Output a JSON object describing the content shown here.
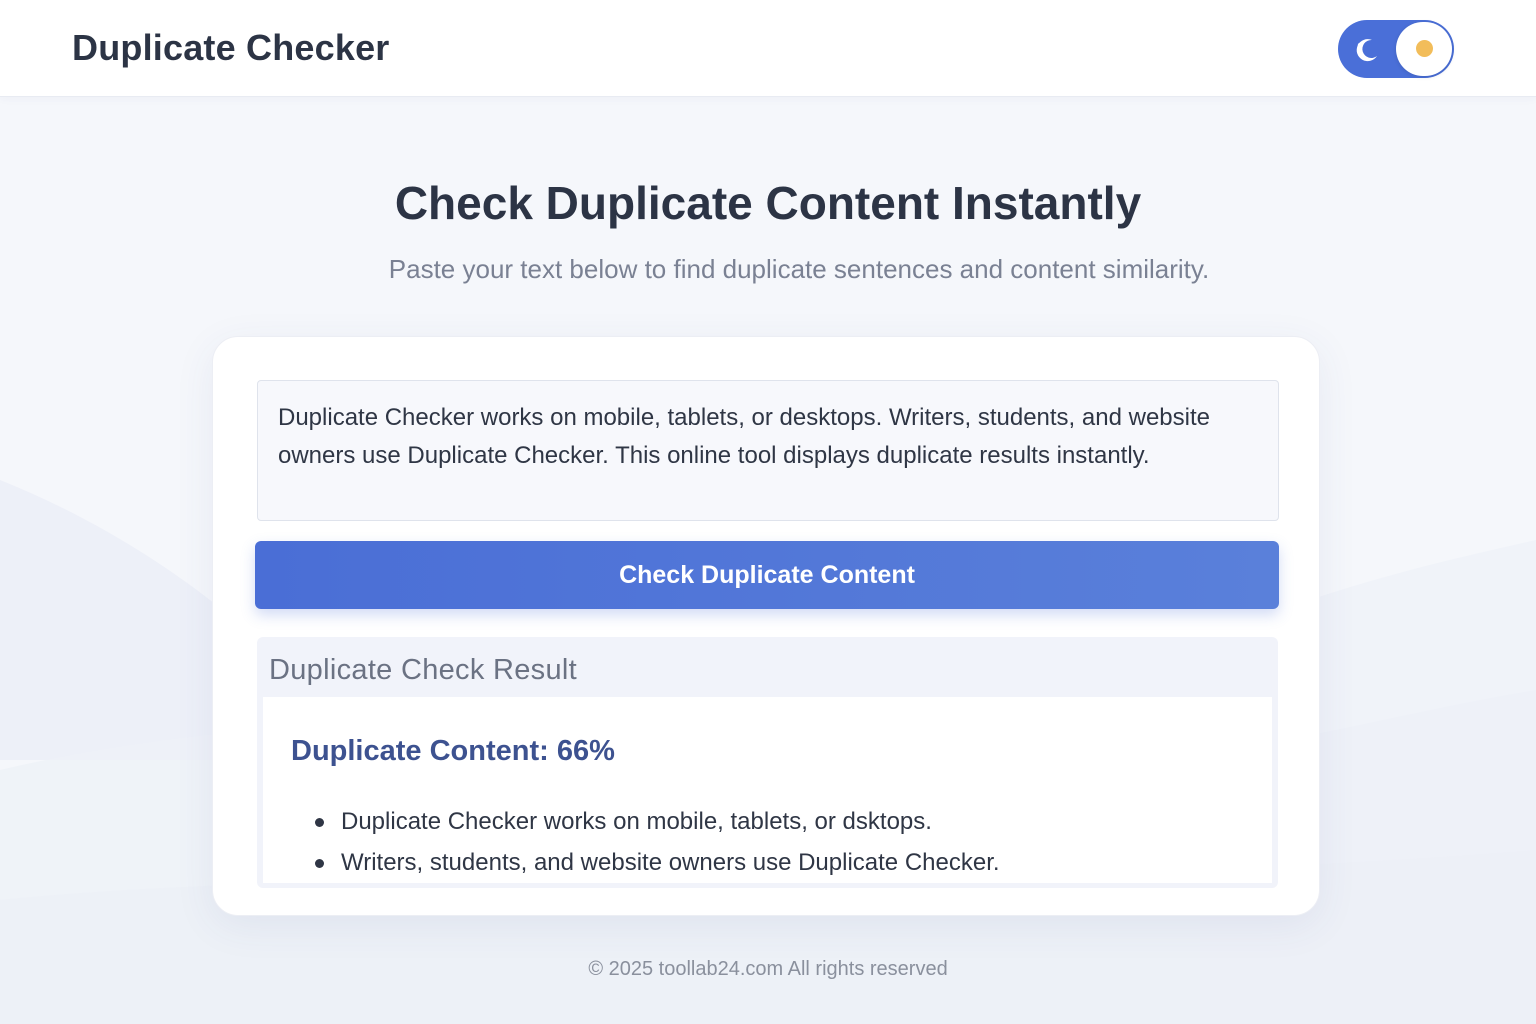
{
  "header": {
    "brand": "Duplicate Checker",
    "theme_toggle": {
      "left_icon": "moon-icon",
      "right_icon": "sun-icon"
    }
  },
  "hero": {
    "title": "Check Duplicate Content Instantly",
    "subtitle": "Paste your text below to find duplicate sentences and content similarity."
  },
  "form": {
    "input_value": "Duplicate Checker works on mobile, tablets, or desktops. Writers, students, and website owners use Duplicate Checker. This online tool displays duplicate results instantly.",
    "button_label": "Check Duplicate Content"
  },
  "result": {
    "title": "Duplicate Check Result",
    "percent_label": "Duplicate Content: 66%",
    "items": [
      "Duplicate Checker works on mobile, tablets, or dsktops.",
      "Writers, students, and website owners use Duplicate Checker."
    ]
  },
  "footer": {
    "text": "© 2025 toollab24.com All rights reserved"
  },
  "colors": {
    "accent": "#4a6fd8",
    "background": "#f5f7fb",
    "percent_text": "#3d5290",
    "sun": "#f2bd5a"
  }
}
